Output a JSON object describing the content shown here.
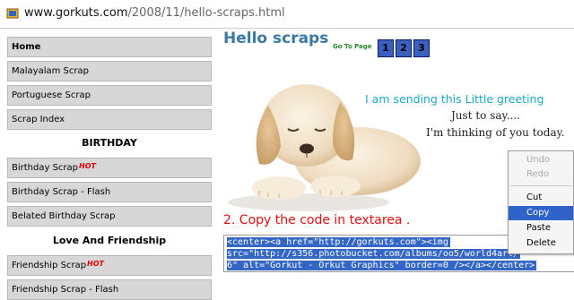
{
  "address_bar": {
    "host": "www.gorkuts.com",
    "path": "/2008/11/hello-scraps.html"
  },
  "sidebar": {
    "items": [
      {
        "label": "Home",
        "hot": false
      },
      {
        "label": "Malayalam Scrap",
        "hot": false
      },
      {
        "label": "Portuguese Scrap",
        "hot": false
      },
      {
        "label": "Scrap Index",
        "hot": false
      },
      {
        "label": "Birthday Scrap",
        "hot": true
      },
      {
        "label": "Birthday Scrap - Flash",
        "hot": false
      },
      {
        "label": "Belated Birthday Scrap",
        "hot": false
      },
      {
        "label": "Friendship Scrap",
        "hot": true
      },
      {
        "label": "Friendship Scrap - Flash",
        "hot": false
      }
    ],
    "headings": [
      "BIRTHDAY",
      "Love And Friendship"
    ],
    "hot_badge": "HOT"
  },
  "main": {
    "title": "Hello scraps",
    "goto_label": "Go To Page",
    "pages": [
      "1",
      "2",
      "3"
    ],
    "greeting": {
      "line1": "I am sending this Little greeting",
      "line2": "Just to say....",
      "line3": "I'm thinking of you today."
    },
    "copy_instruction": "2. Copy the  code in textarea .",
    "code_lines": [
      "<center><a href=\"http://gorkuts.com\"><img",
      "src=\"http://s356.photobucket.com/albums/oo5/world4art/",
      "6\" alt=\"Gorkut - Orkut Graphics\" border=0 /></a></center>"
    ]
  },
  "context_menu": {
    "items": [
      {
        "label": "Undo",
        "enabled": false,
        "selected": false
      },
      {
        "label": "Redo",
        "enabled": false,
        "selected": false
      },
      {
        "label": "Cut",
        "enabled": true,
        "selected": false
      },
      {
        "label": "Copy",
        "enabled": true,
        "selected": true
      },
      {
        "label": "Paste",
        "enabled": true,
        "selected": false
      },
      {
        "label": "Delete",
        "enabled": true,
        "selected": false
      }
    ]
  },
  "colors": {
    "title": "#3a78a8",
    "page_button": "#3a5fbf",
    "instruction": "#e01010",
    "selection": "#3466c6",
    "greeting_text": "#1aa8c8"
  }
}
